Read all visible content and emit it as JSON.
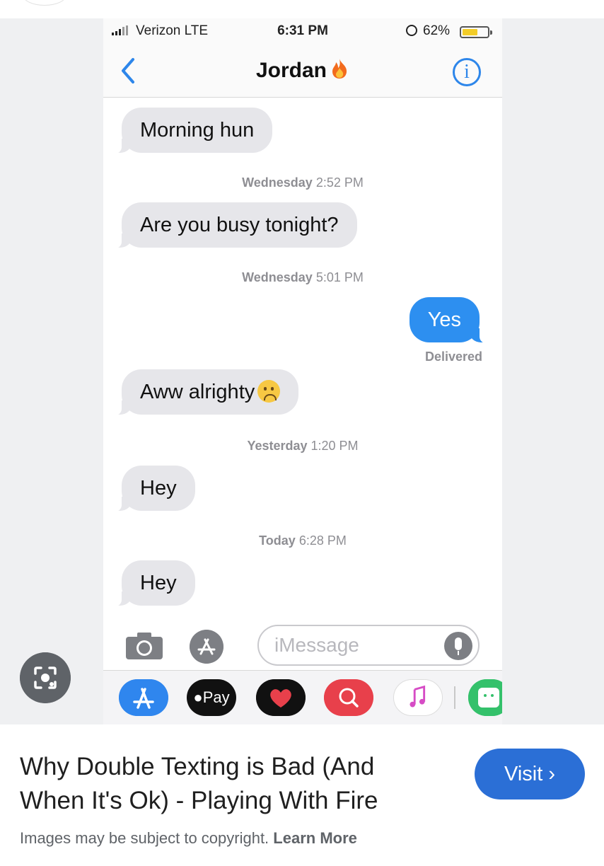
{
  "status_bar": {
    "carrier": "Verizon  LTE",
    "time": "6:31 PM",
    "battery_pct": "62%",
    "battery_level": 0.62
  },
  "conversation": {
    "contact_name": "Jordan",
    "title_emoji": "🔥",
    "back_icon": "chevron-left-icon",
    "info_icon": "info-icon",
    "info_glyph": "i"
  },
  "messages": [
    {
      "type": "in",
      "text": "Morning hun"
    },
    {
      "type": "ts",
      "day": "Wednesday",
      "time": "2:52 PM"
    },
    {
      "type": "in",
      "text": "Are you busy tonight?"
    },
    {
      "type": "ts",
      "day": "Wednesday",
      "time": "5:01 PM"
    },
    {
      "type": "out",
      "text": "Yes"
    },
    {
      "type": "status",
      "text": "Delivered"
    },
    {
      "type": "in",
      "text": "Aww alrighty",
      "emoji": "slightly-frowning-face"
    },
    {
      "type": "ts",
      "day": "Yesterday",
      "time": "1:20 PM"
    },
    {
      "type": "in",
      "text": "Hey"
    },
    {
      "type": "ts",
      "day": "Today",
      "time": "6:28 PM"
    },
    {
      "type": "in",
      "text": "Hey"
    }
  ],
  "input_bar": {
    "placeholder": "iMessage",
    "camera_icon": "camera-icon",
    "apps_icon": "app-store-icon",
    "mic_icon": "microphone-icon"
  },
  "app_tray": {
    "apps": [
      "app-store-icon",
      "apple-pay-icon",
      "digital-touch-icon",
      "images-search-icon",
      "music-icon",
      "stickers-icon"
    ],
    "apple_pay_label": "Pay"
  },
  "lens_button": {
    "icon": "lens-icon"
  },
  "result": {
    "title_line1": "Why Double Texting is Bad (And",
    "title_line2": "When It's Ok) - Playing With Fire",
    "visit_label": "Visit",
    "visit_chevron": "›",
    "copyright_text": "Images may be subject to copyright.",
    "learn_more": "Learn More"
  },
  "colors": {
    "imessage_blue": "#2d8ff0",
    "incoming_gray": "#e6e6ea",
    "visit_button": "#2b6fd6"
  }
}
